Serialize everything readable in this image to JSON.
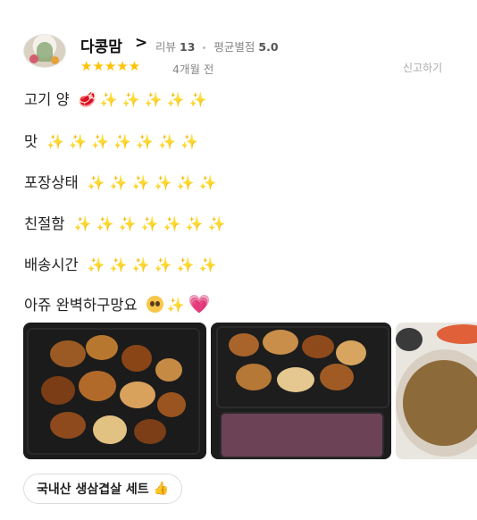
{
  "review": {
    "nickname": "다콩맘",
    "chevron": ">",
    "review_count_label": "리뷰",
    "review_count": "13",
    "avg_star_label": "평균별점",
    "avg_star": "5.0",
    "rating": 5,
    "stars": "★★★★★",
    "date": "4개월 전",
    "report_label": "신고하기",
    "lines": [
      {
        "text": "고기 양",
        "emoji": "🥩",
        "sparkles": "✨ ✨ ✨ ✨ ✨"
      },
      {
        "text": "맛",
        "sparkles": "✨ ✨ ✨ ✨ ✨ ✨ ✨"
      },
      {
        "text": "포장상태",
        "sparkles": "✨ ✨ ✨ ✨ ✨ ✨"
      },
      {
        "text": "친절함",
        "sparkles": "✨ ✨ ✨ ✨ ✨ ✨ ✨"
      },
      {
        "text": "배송시간",
        "sparkles": "✨ ✨ ✨ ✨ ✨ ✨"
      },
      {
        "text": "아쥬 완벽하구망요",
        "sparkles": "✨",
        "heart": "💗"
      }
    ],
    "menu_tag": "국내산 생삼겹살 세트",
    "thumb_icon": "👍"
  },
  "colors": {
    "star": "#ffc200",
    "sparkle": "#f3d24a",
    "heart": "#f25ea6",
    "thumb": "#3a7bd5"
  }
}
